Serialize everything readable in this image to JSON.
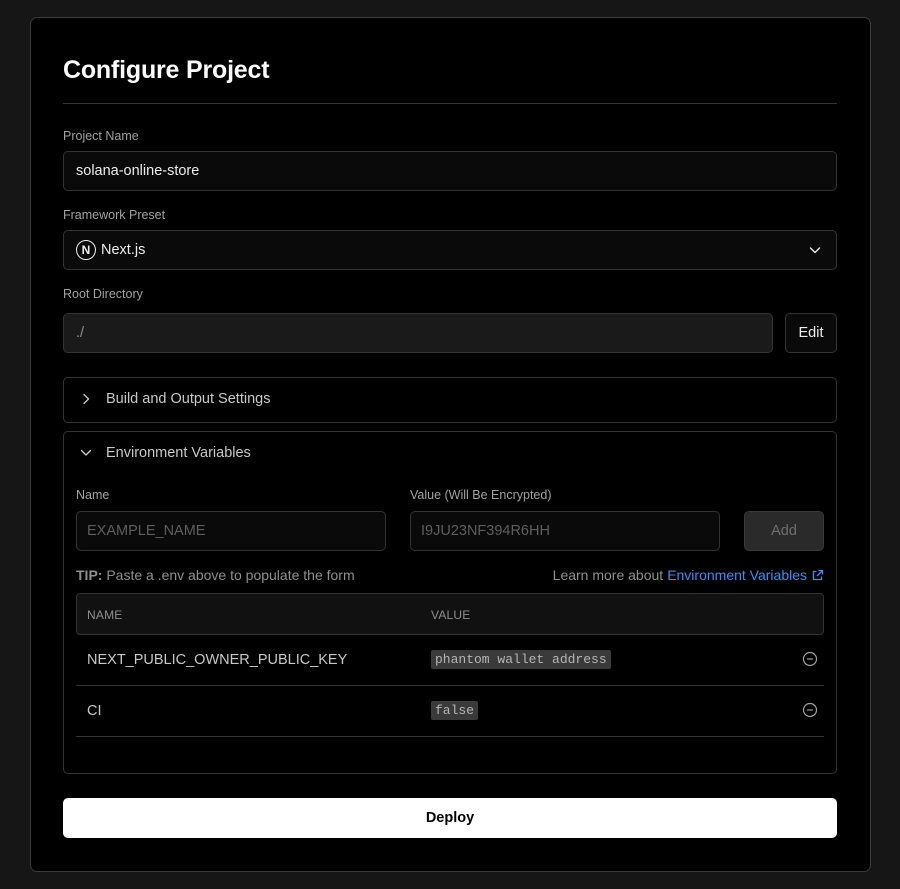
{
  "page": {
    "title": "Configure Project"
  },
  "project_name": {
    "label": "Project Name",
    "value": "solana-online-store"
  },
  "framework": {
    "label": "Framework Preset",
    "value": "Next.js",
    "logo_letter": "N"
  },
  "root_dir": {
    "label": "Root Directory",
    "value": "./",
    "edit_label": "Edit"
  },
  "build_settings": {
    "label": "Build and Output Settings"
  },
  "env": {
    "label": "Environment Variables",
    "name_label": "Name",
    "value_label": "Value (Will Be Encrypted)",
    "name_placeholder": "EXAMPLE_NAME",
    "value_placeholder": "I9JU23NF394R6HH",
    "add_label": "Add",
    "tip_prefix": "TIP:",
    "tip_text": "Paste a .env above to populate the form",
    "learn_prefix": "Learn more about",
    "learn_link": "Environment Variables",
    "table": {
      "col_name": "NAME",
      "col_value": "VALUE",
      "rows": [
        {
          "name": "NEXT_PUBLIC_OWNER_PUBLIC_KEY",
          "value": "phantom wallet address"
        },
        {
          "name": "CI",
          "value": "false"
        }
      ]
    }
  },
  "deploy_label": "Deploy",
  "colors": {
    "accent_link": "#3291ff",
    "background": "#000000",
    "border": "#333333"
  }
}
